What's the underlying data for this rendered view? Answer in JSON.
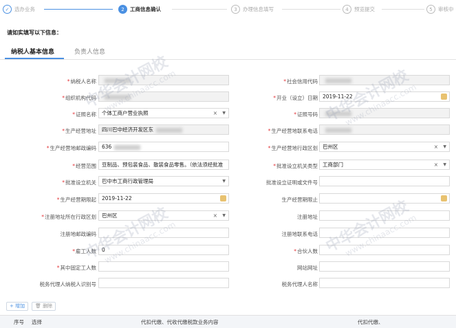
{
  "steps": [
    {
      "num": "1",
      "label": "选办业务"
    },
    {
      "num": "2",
      "label": "工商信息确认"
    },
    {
      "num": "3",
      "label": "办理信息填写"
    },
    {
      "num": "4",
      "label": "预览提交"
    },
    {
      "num": "5",
      "label": "审核中"
    }
  ],
  "instruction": "请如实填写以下信息：",
  "tabs": [
    "纳税人基本信息",
    "负责人信息"
  ],
  "form": {
    "taxpayer_name": {
      "label": "纳税人名称",
      "value": ""
    },
    "credit_code": {
      "label": "社会信用代码",
      "value": ""
    },
    "org_code": {
      "label": "组织机构代码",
      "value": ""
    },
    "open_date": {
      "label": "开业（设立）日期",
      "value": "2019-11-22"
    },
    "cert_name": {
      "label": "证照名称",
      "value": "个体工商户营业执照"
    },
    "cert_no": {
      "label": "证照号码",
      "value": ""
    },
    "prod_addr": {
      "label": "生产经营地址",
      "value": "四川巴中经济开发区东"
    },
    "prod_phone": {
      "label": "生产经营地联系电话",
      "value": ""
    },
    "prod_zip": {
      "label": "生产经营地邮政编码",
      "value": "636"
    },
    "prod_region": {
      "label": "生产经营地行政区划",
      "value": "巴州区"
    },
    "scope": {
      "label": "经营范围",
      "value": "豆制品、预包装食品、散装食品零售。（依法须经批准"
    },
    "approve_type": {
      "label": "批准设立机关类型",
      "value": "工商部门"
    },
    "approve_org": {
      "label": "批准设立机关",
      "value": "巴中市工商行政管理局"
    },
    "approve_doc": {
      "label": "批准设立证明或文件号",
      "value": ""
    },
    "period_start": {
      "label": "生产经营期限起",
      "value": "2019-11-22"
    },
    "period_end": {
      "label": "生产经营期限止",
      "value": ""
    },
    "reg_region": {
      "label": "注册地址所在行政区划",
      "value": "巴州区"
    },
    "reg_addr": {
      "label": "注册地址",
      "value": ""
    },
    "reg_zip": {
      "label": "注册地邮政编码",
      "value": ""
    },
    "reg_phone": {
      "label": "注册地联系电话",
      "value": ""
    },
    "employees": {
      "label": "雇工人数",
      "value": "0"
    },
    "partners": {
      "label": "合伙人数",
      "value": ""
    },
    "foreign_emp": {
      "label": "其中固定工人数",
      "value": ""
    },
    "website": {
      "label": "网站网址",
      "value": ""
    },
    "agent_id": {
      "label": "税务代理人纳税人识别号",
      "value": ""
    },
    "agent_name": {
      "label": "税务代理人名称",
      "value": ""
    }
  },
  "buttons": {
    "add": "+ 增加",
    "delete": "删除"
  },
  "table": {
    "headers": [
      "序号",
      "选择",
      "代扣代缴、代收代缴税款业务内容",
      "代扣代缴、"
    ]
  },
  "watermark": {
    "cn": "中华会计网校",
    "en": "www.chinaacc.com"
  },
  "colors": {
    "accent": "#4a90e2",
    "required": "#e4393c",
    "calendar": "#e8c270"
  }
}
